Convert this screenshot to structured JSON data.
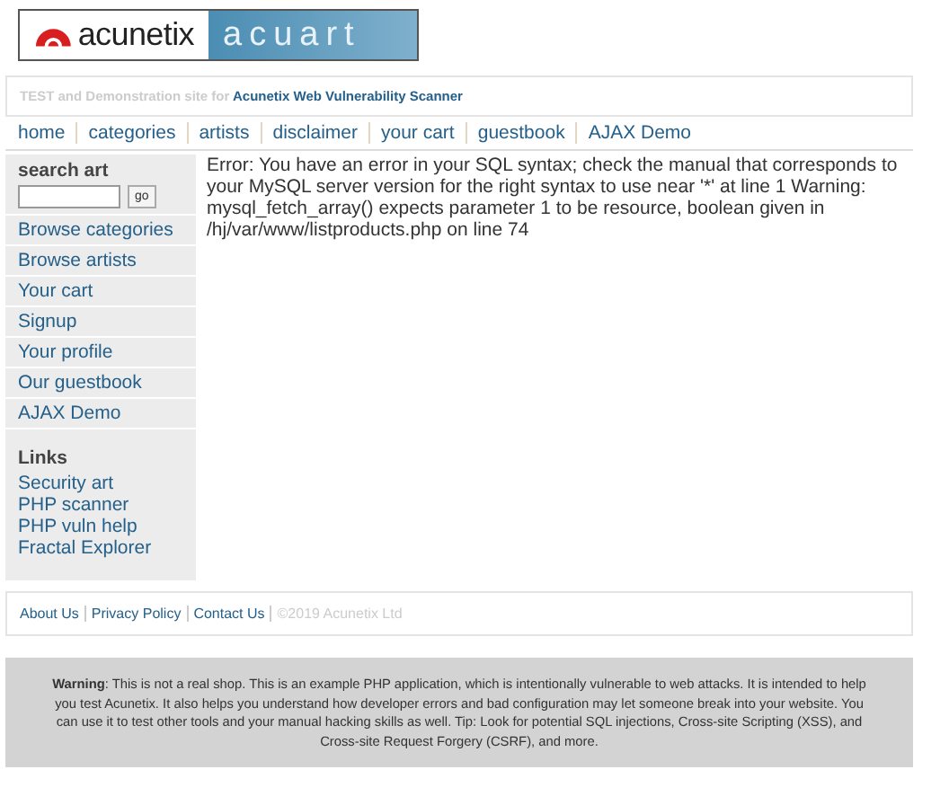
{
  "logo": {
    "brand": "acunetix",
    "site": "acuart"
  },
  "tagline": {
    "text": "TEST and Demonstration site for",
    "link": "Acunetix Web Vulnerability Scanner"
  },
  "nav": [
    "home",
    "categories",
    "artists",
    "disclaimer",
    "your cart",
    "guestbook",
    "AJAX Demo"
  ],
  "sidebar": {
    "search_title": "search art",
    "search_button": "go",
    "menu": [
      "Browse categories",
      "Browse artists",
      "Your cart",
      "Signup",
      "Your profile",
      "Our guestbook",
      "AJAX Demo"
    ],
    "links_title": "Links",
    "links": [
      "Security art",
      "PHP scanner",
      "PHP vuln help",
      "Fractal Explorer"
    ]
  },
  "content": {
    "error": "Error: You have an error in your SQL syntax; check the manual that corresponds to your MySQL server version for the right syntax to use near '*' at line 1 Warning: mysql_fetch_array() expects parameter 1 to be resource, boolean given in /hj/var/www/listproducts.php on line 74"
  },
  "footer": {
    "links": [
      "About Us",
      "Privacy Policy",
      "Contact Us"
    ],
    "copyright": "©2019 Acunetix Ltd"
  },
  "warning": "**Warning**: This is not a real shop. This is an example PHP application, which is intentionally vulnerable to web attacks. It is intended to help you test Acunetix. It also helps you understand how developer errors and bad configuration may let someone break into your website. You can use it to test other tools and your manual hacking skills as well. Tip: Look for potential SQL injections, Cross-site Scripting (XSS), and Cross-site Request Forgery (CSRF), and more."
}
